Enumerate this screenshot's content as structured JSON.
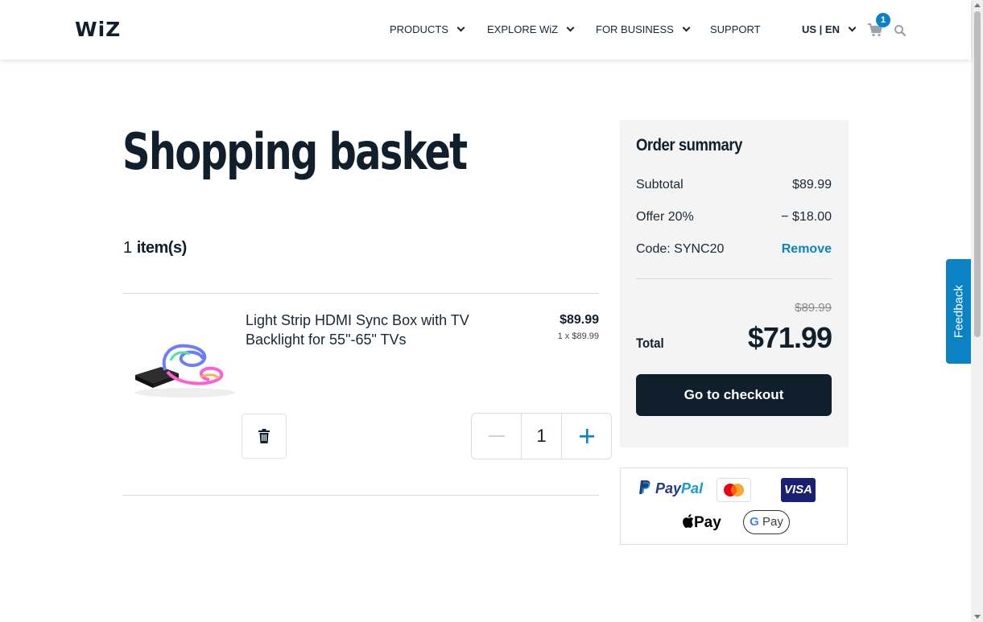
{
  "header": {
    "logo": "WiZ",
    "nav": [
      "PRODUCTS",
      "EXPLORE WiZ",
      "FOR BUSINESS",
      "SUPPORT"
    ],
    "locale": "US | EN",
    "cart_count": "1",
    "icons": [
      "cart-icon",
      "search-icon"
    ]
  },
  "main": {
    "title": "Shopping basket",
    "item_count_num": "1",
    "item_count_label": "item(s)",
    "product": {
      "name": "Light Strip HDMI Sync Box with TV Backlight for 55\"-65\" TVs",
      "price": "$89.99",
      "unit_price": "1 x $89.99",
      "quantity": "1"
    }
  },
  "summary": {
    "title": "Order summary",
    "rows": [
      {
        "label": "Subtotal",
        "value": "$89.99"
      },
      {
        "label": "Offer 20%",
        "value": "− $18.00"
      },
      {
        "label": "Code: SYNC20",
        "value": "Remove"
      }
    ],
    "original_total": "$89.99",
    "total_label": "Total",
    "total_value": "$71.99",
    "checkout_label": "Go to checkout"
  },
  "payments": {
    "paypal_a": "Pay",
    "paypal_b": "Pal",
    "visa": "VISA",
    "applepay": "Pay",
    "gpay": "Pay",
    "gpay_g": "G"
  },
  "feedback": "Feedback",
  "colors": {
    "accent": "#0b82c4",
    "dark": "#111f2c"
  }
}
